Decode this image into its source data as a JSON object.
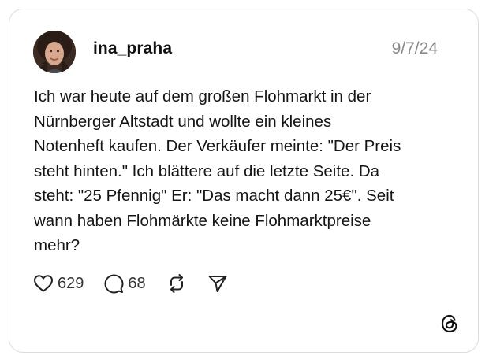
{
  "post": {
    "username": "ina_praha",
    "date": "9/7/24",
    "text": "Ich war heute auf dem großen Flohmarkt in der\nNürnberger Altstadt und wollte ein kleines\nNotenheft kaufen. Der Verkäufer meinte: \"Der Preis\nsteht hinten.\" Ich blättere auf die letzte Seite. Da\nsteht: \"25 Pfennig\" Er: \"Das macht dann 25€\". Seit\nwann haben Flohmärkte keine Flohmarktpreise\nmehr?"
  },
  "actions": {
    "likes": "629",
    "replies": "68",
    "icons": [
      "heart-icon",
      "comment-icon",
      "repost-icon",
      "share-icon"
    ]
  },
  "brand": {
    "logo": "threads-logo-icon"
  },
  "colors": {
    "text": "#141414",
    "muted": "#8a8a8a",
    "border": "#dcdcdc"
  }
}
